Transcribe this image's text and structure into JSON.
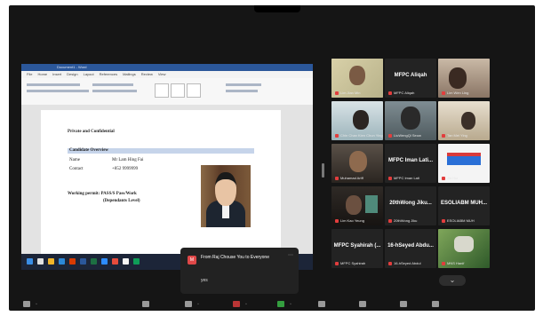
{
  "meeting": {
    "chat_toast": {
      "sender_initial": "M",
      "from": "From Raj Chouse You to Everyone",
      "message": "yes"
    },
    "shared_doc": {
      "window_title": "Document1 - Word",
      "tabs": [
        "File",
        "Home",
        "Insert",
        "Design",
        "Layout",
        "References",
        "Mailings",
        "Review",
        "View"
      ],
      "heading": "Private and Confidential",
      "section_title": "Candidate Overview",
      "rows": [
        {
          "label": "Name",
          "value": "Mr Lam Hing Fai"
        },
        {
          "label": "Contact",
          "value": "+852 9999999"
        }
      ],
      "position_line1": "Working permit: PASS/S Pass/Work",
      "position_line2": "(Dependants Level)"
    },
    "gallery": [
      {
        "name": "Lim Jian Min",
        "label": "",
        "muted": true
      },
      {
        "name": "MFPC Aliqah",
        "label": "MFPC Aliqah",
        "muted": true
      },
      {
        "name": "Lim Wen Ling",
        "label": "",
        "muted": true
      },
      {
        "name": "Chin Chan Kien Chun Ying",
        "label": "",
        "muted": true
      },
      {
        "name": "LiuWengQi Seow",
        "label": "",
        "muted": true
      },
      {
        "name": "Tan Mei Ying",
        "label": "",
        "muted": true
      },
      {
        "name": "Muhamad Ariff",
        "label": "",
        "muted": true
      },
      {
        "name": "MFPC Iman Lati",
        "label": "MFPC Iman Lati...",
        "muted": true
      },
      {
        "name": "Jia Hui",
        "label": "",
        "muted": true
      },
      {
        "name": "Lim Kao Yeung",
        "label": "",
        "muted": true
      },
      {
        "name": "20thWong Jiku",
        "label": "20thWong  Jiku...",
        "muted": true
      },
      {
        "name": "ESOLIABM MUH",
        "label": "ESOLIABM MUH...",
        "muted": true
      },
      {
        "name": "MFPC Syahirah",
        "label": "MFPC Syahirah  (...",
        "muted": true
      },
      {
        "name": "16-hSeyed Abdul",
        "label": "16-hSeyed  Abdu...",
        "muted": true
      },
      {
        "name": "MNS Hanif",
        "label": "",
        "muted": true
      }
    ]
  }
}
